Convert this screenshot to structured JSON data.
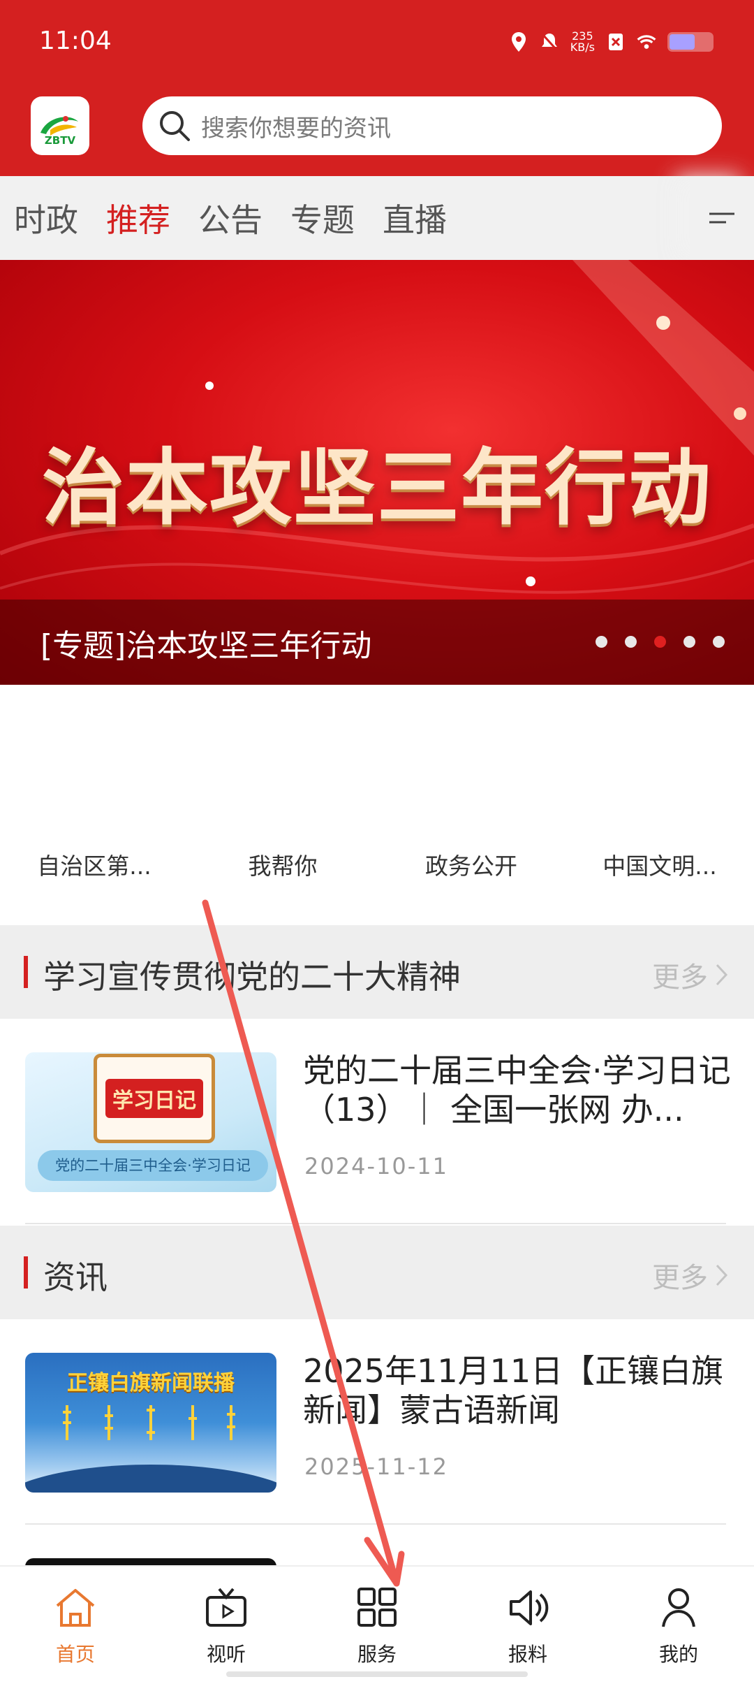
{
  "status": {
    "time": "11:04",
    "net_speed_value": "235",
    "net_speed_unit": "KB/s",
    "battery_level": 0.6
  },
  "header": {
    "logo_text": "ZBTV",
    "search_placeholder": "搜索你想要的资讯"
  },
  "tabs": [
    {
      "label": "时政",
      "active": false
    },
    {
      "label": "推荐",
      "active": true
    },
    {
      "label": "公告",
      "active": false
    },
    {
      "label": "专题",
      "active": false
    },
    {
      "label": "直播",
      "active": false
    }
  ],
  "banner": {
    "image_text": "治本攻坚三年行动",
    "caption": "[专题]治本攻坚三年行动",
    "dots": 5,
    "active_dot": 3
  },
  "quick_links": [
    "自治区第...",
    "我帮你",
    "政务公开",
    "中国文明..."
  ],
  "sections": [
    {
      "title": "学习宣传贯彻党的二十大精神",
      "more": "更多",
      "items": [
        {
          "title": "党的二十届三中全会·学习日记（13）｜ 全国一张网  办...",
          "date": "2024-10-11",
          "thumb_text": "学习日记",
          "thumb_caption": "党的二十届三中全会·学习日记"
        }
      ]
    },
    {
      "title": "资讯",
      "more": "更多",
      "items": [
        {
          "title": "2025年11月11日【正镶白旗新闻】蒙古语新闻",
          "date": "2025-11-12",
          "thumb_text": "正镶白旗新闻联播"
        }
      ]
    }
  ],
  "bottom_nav": [
    {
      "label": "首页",
      "icon": "home-icon",
      "active": true
    },
    {
      "label": "视听",
      "icon": "tv-icon",
      "active": false
    },
    {
      "label": "服务",
      "icon": "grid-icon",
      "active": false
    },
    {
      "label": "报料",
      "icon": "speaker-icon",
      "active": false
    },
    {
      "label": "我的",
      "icon": "user-icon",
      "active": false
    }
  ],
  "colors": {
    "brand_red": "#d42020",
    "active_nav": "#e87830",
    "annotation_arrow": "#ee5a52"
  }
}
